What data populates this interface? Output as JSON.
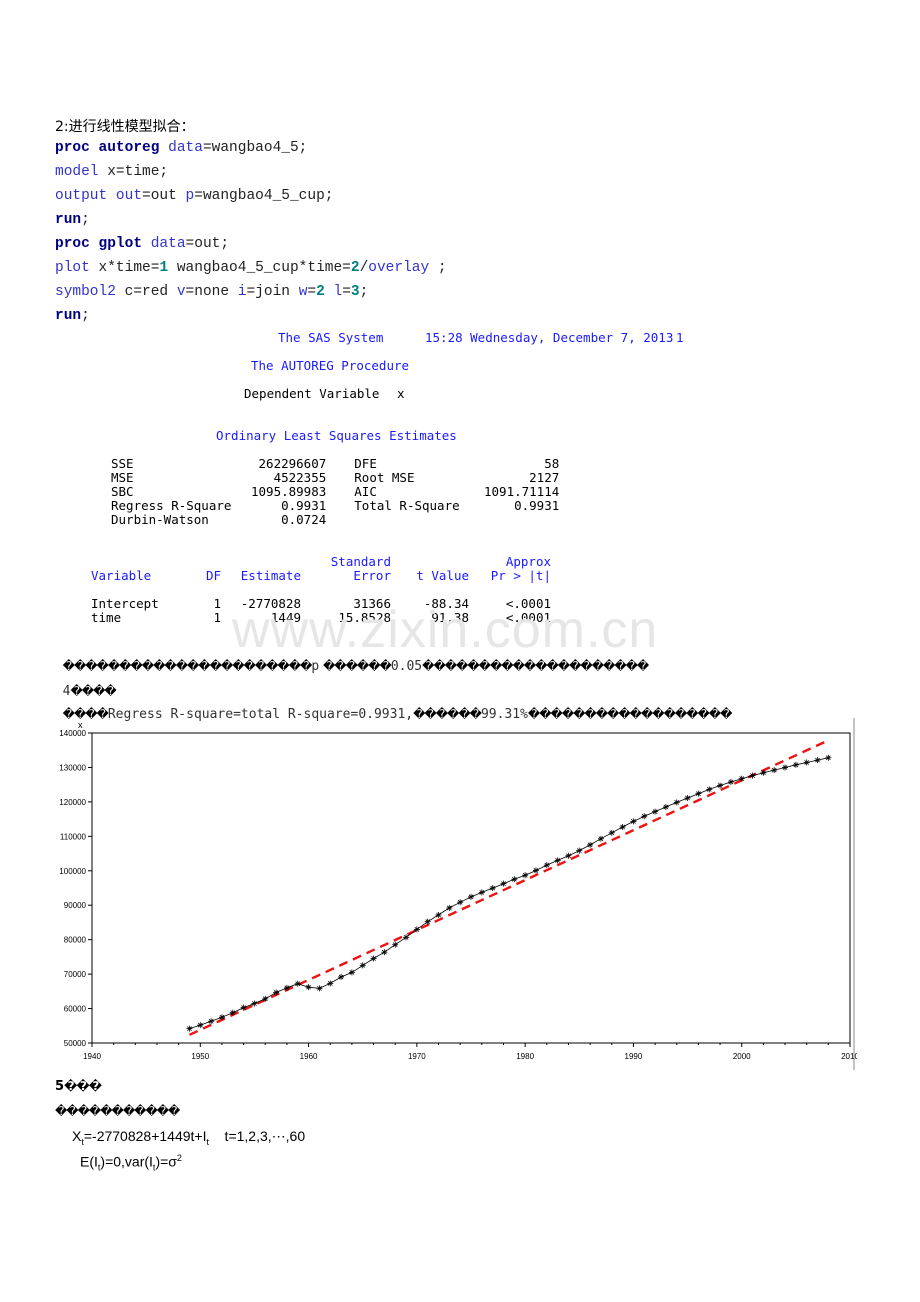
{
  "heading": "2:进行线性模型拟合：",
  "code": [
    [
      [
        "kw",
        "proc "
      ],
      [
        "kw",
        "autoreg "
      ],
      [
        "bl",
        "data"
      ],
      [
        "tx",
        "=wangbao4_5;"
      ]
    ],
    [
      [
        "bl",
        "model "
      ],
      [
        "tx",
        "x=time;"
      ]
    ],
    [
      [
        "bl",
        "output "
      ],
      [
        "bl",
        "out"
      ],
      [
        "tx",
        "=out "
      ],
      [
        "bl",
        "p"
      ],
      [
        "tx",
        "=wangbao4_5_cup;"
      ]
    ],
    [
      [
        "kw",
        "run"
      ],
      [
        "tx",
        ";"
      ]
    ],
    [
      [
        "kw",
        "proc "
      ],
      [
        "kw",
        "gplot "
      ],
      [
        "bl",
        "data"
      ],
      [
        "tx",
        "=out;"
      ]
    ],
    [
      [
        "bl",
        "plot "
      ],
      [
        "tx",
        "x*time="
      ],
      [
        "num",
        "1"
      ],
      [
        "tx",
        " wangbao4_5_cup*time="
      ],
      [
        "num",
        "2"
      ],
      [
        "tx",
        "/"
      ],
      [
        "bl",
        "overlay"
      ],
      [
        "tx",
        " ;"
      ]
    ],
    [
      [
        "bl",
        "symbol2 "
      ],
      [
        "tx",
        "c=red "
      ],
      [
        "bl",
        "v"
      ],
      [
        "tx",
        "=none "
      ],
      [
        "bl",
        "i"
      ],
      [
        "tx",
        "=join "
      ],
      [
        "bl",
        "w"
      ],
      [
        "tx",
        "="
      ],
      [
        "num",
        "2"
      ],
      [
        "bl",
        " l"
      ],
      [
        "tx",
        "="
      ],
      [
        "num",
        "3"
      ],
      [
        "tx",
        ";"
      ]
    ],
    [
      [
        "kw",
        "run"
      ],
      [
        "tx",
        ";"
      ]
    ]
  ],
  "sas": {
    "system_title": "The SAS System",
    "datetime": "15:28 Wednesday, December 7, 2013",
    "page": "1",
    "procedure": "The AUTOREG Procedure",
    "dep_var_label": "Dependent Variable",
    "dep_var": "x",
    "ols_title": "Ordinary Least Squares Estimates",
    "stats": [
      [
        "SSE",
        "262296607",
        "DFE",
        "58"
      ],
      [
        "MSE",
        "4522355",
        "Root MSE",
        "2127"
      ],
      [
        "SBC",
        "1095.89983",
        "AIC",
        "1091.71114"
      ],
      [
        "Regress R-Square",
        "0.9931",
        "Total R-Square",
        "0.9931"
      ],
      [
        "Durbin-Watson",
        "0.0724",
        "",
        ""
      ]
    ],
    "param_header_top": [
      "",
      "",
      "",
      "Standard",
      "",
      "Approx"
    ],
    "param_header": [
      "Variable",
      "DF",
      "Estimate",
      "Error",
      "t Value",
      "Pr > |t|"
    ],
    "params": [
      [
        "Intercept",
        "1",
        "-2770828",
        "31366",
        "-88.34",
        "<.0001"
      ],
      [
        "time",
        "1",
        "1449",
        "15.8528",
        "91.38",
        "<.0001"
      ]
    ]
  },
  "watermark": "www.zixin.com.cn",
  "note1_prefix": "����������������������",
  "note1_p": "p",
  "note1_mid": "������",
  "note1_val": "0.05",
  "note1_suffix": "��������������������",
  "note2_num": "4",
  "note2_suffix": "����",
  "note3_prefix": "����",
  "note3_formula": "Regress R-square=total R-square=0.9931,",
  "note3_mid": "������",
  "note3_pct": "99.31%",
  "note3_suffix": "������������������",
  "chart_data": {
    "type": "line",
    "ylabel": "x",
    "xlim": [
      1940,
      2010
    ],
    "ylim": [
      50000,
      140000
    ],
    "xticks": [
      "1940",
      "1950",
      "1960",
      "1970",
      "1980",
      "1990",
      "2000",
      "2010"
    ],
    "yticks": [
      "50000",
      "60000",
      "70000",
      "80000",
      "90000",
      "100000",
      "110000",
      "120000",
      "130000",
      "140000"
    ],
    "colors": {
      "series1": "#000000",
      "series2": "#ee1111",
      "frame": "#000000"
    },
    "series": [
      {
        "marker": "star",
        "x": [
          1949,
          1950,
          1951,
          1952,
          1953,
          1954,
          1955,
          1956,
          1957,
          1958,
          1959,
          1960,
          1961,
          1962,
          1963,
          1964,
          1965,
          1966,
          1967,
          1968,
          1969,
          1970,
          1971,
          1972,
          1973,
          1974,
          1975,
          1976,
          1977,
          1978,
          1979,
          1980,
          1981,
          1982,
          1983,
          1984,
          1985,
          1986,
          1987,
          1988,
          1989,
          1990,
          1991,
          1992,
          1993,
          1994,
          1995,
          1996,
          1997,
          1998,
          1999,
          2000,
          2001,
          2002,
          2003,
          2004,
          2005,
          2006,
          2007,
          2008
        ],
        "values": [
          54167,
          55196,
          56300,
          57482,
          58796,
          60266,
          61465,
          62828,
          64653,
          65994,
          67207,
          66207,
          65859,
          67295,
          69172,
          70499,
          72538,
          74542,
          76368,
          78534,
          80671,
          82992,
          85229,
          87177,
          89211,
          90859,
          92420,
          93717,
          94974,
          96259,
          97542,
          98705,
          100072,
          101654,
          103008,
          104357,
          105851,
          107507,
          109300,
          111026,
          112704,
          114333,
          115823,
          117171,
          118517,
          119850,
          121121,
          122389,
          123626,
          124761,
          125786,
          126743,
          127627,
          128453,
          129227,
          129988,
          130756,
          131448,
          132129,
          132802
        ]
      },
      {
        "style": "dashed",
        "x": [
          1949,
          2008
        ],
        "values": [
          52373,
          137864
        ]
      }
    ]
  }
}
